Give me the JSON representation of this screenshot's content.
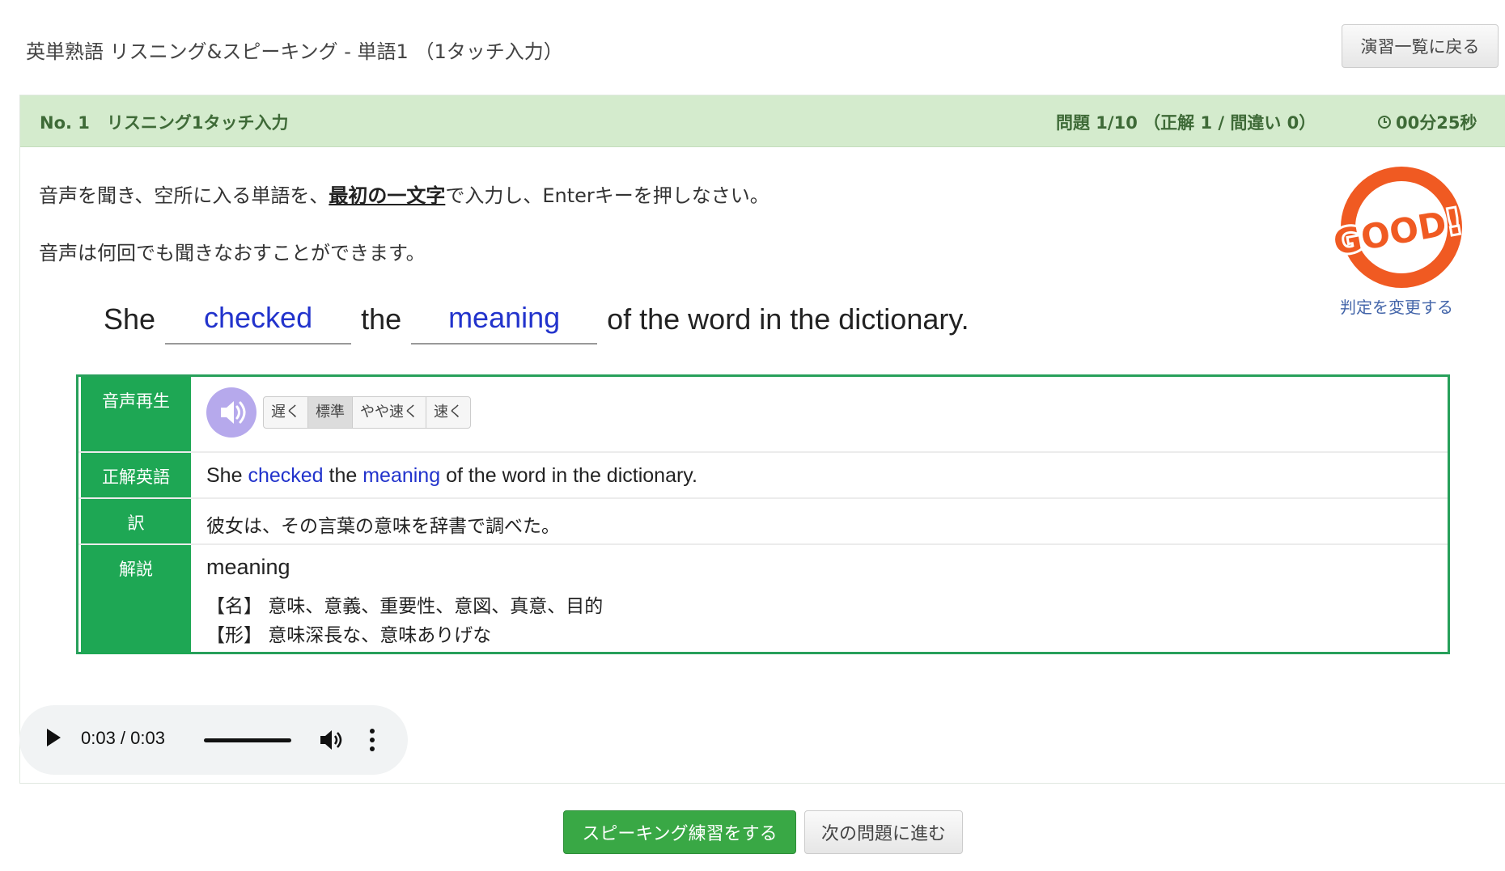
{
  "page": {
    "title": "英単熟語 リスニング&スピーキング - 単語1 （1タッチ入力）",
    "back_button": "演習一覧に戻る"
  },
  "header": {
    "question_label": "No. 1　リスニング1タッチ入力",
    "progress": "問題 1/10 （正解 1 / 間違い 0）",
    "timer": "00分25秒"
  },
  "instructions": {
    "line1_prefix": "音声を聞き、空所に入る単語を、",
    "line1_emphasis": "最初の一文字",
    "line1_suffix": "で入力し、Enterキーを押しなさい。",
    "line2": "音声は何回でも聞きなおすことができます。"
  },
  "sentence": {
    "w1": "She",
    "blank1": "checked",
    "w2": "the",
    "blank2": "meaning",
    "w3": "of the word in the dictionary."
  },
  "judgement": {
    "stamp_text": "GOOD!",
    "change_link": "判定を変更する",
    "stamp_color": "#f05a22"
  },
  "table": {
    "audio_label": "音声再生",
    "speed_options": [
      "遅く",
      "標準",
      "やや速く",
      "速く"
    ],
    "selected_speed": "標準",
    "answer_label": "正解英語",
    "answer": {
      "p1": "She ",
      "h1": "checked",
      "p2": " the ",
      "h2": "meaning",
      "p3": " of the word in the dictionary."
    },
    "translation_label": "訳",
    "translation": "彼女は、その言葉の意味を辞書で調べた。",
    "explanation_label": "解説",
    "explanation_word": "meaning",
    "explanation_lines": [
      "【名】 意味、意義、重要性、意図、真意、目的",
      "【形】 意味深長な、意味ありげな"
    ]
  },
  "audio_player": {
    "time": "0:03 / 0:03",
    "progress_fraction": 1.0
  },
  "buttons": {
    "speaking": "スピーキング練習をする",
    "next": "次の問題に進む"
  },
  "colors": {
    "accent_green": "#1ea754",
    "header_green": "#d4ebcd",
    "answer_blue": "#2233cc"
  }
}
